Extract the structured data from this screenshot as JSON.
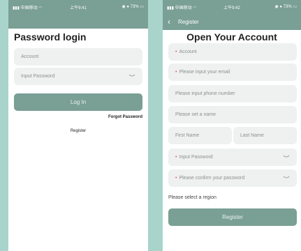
{
  "login_screen": {
    "status_bar": {
      "carrier": "中国移动",
      "time": "上午9:41",
      "battery": "73%"
    },
    "title": "Password login",
    "account_placeholder": "Account",
    "password_placeholder": "Input Password",
    "login_button": "Log In",
    "forgot_password": "Forgot Password",
    "register_link": "Register"
  },
  "register_screen": {
    "status_bar": {
      "carrier": "中国移动",
      "time": "上午9:42",
      "battery": "73%"
    },
    "nav_title": "Register",
    "title": "Open Your Account",
    "account_placeholder": "Account",
    "email_placeholder": "Please input your email",
    "phone_placeholder": "Please input phone number",
    "name_placeholder": "Please set a name",
    "first_name_placeholder": "First Name",
    "last_name_placeholder": "Last Name",
    "password_placeholder": "Input Password",
    "confirm_password_placeholder": "Please confirm your password",
    "region_label": "Please select a region",
    "register_button": "Register"
  },
  "colors": {
    "background": "#a8d4cc",
    "accent": "#7a9f94",
    "field": "#eef1f0",
    "required": "#e15b5b"
  }
}
